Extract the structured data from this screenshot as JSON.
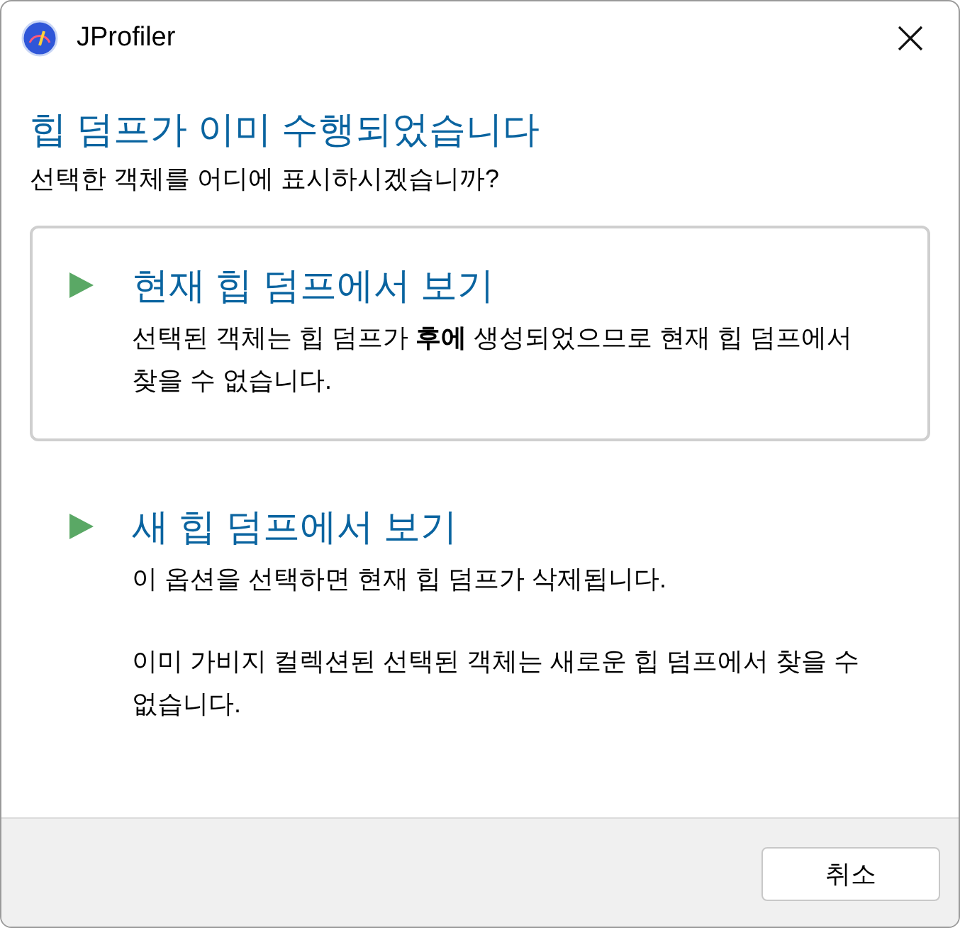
{
  "window": {
    "title": "JProfiler"
  },
  "heading": "힙 덤프가 이미 수행되었습니다",
  "question": "선택한 객체를 어디에 표시하시겠습니까?",
  "options": [
    {
      "title": "현재 힙 덤프에서 보기",
      "selected": true,
      "paragraphs": [
        "선택된 객체는 힙 덤프가 **후에** 생성되었으므로 현재 힙 덤프에서 찾을 수 없습니다."
      ]
    },
    {
      "title": "새 힙 덤프에서 보기",
      "selected": false,
      "paragraphs": [
        "이 옵션을 선택하면 현재 힙 덤프가 삭제됩니다.",
        "이미 가비지 컬렉션된 선택된 객체는 새로운 힙 덤프에서 찾을 수 없습니다."
      ]
    }
  ],
  "buttons": [
    "취소"
  ]
}
